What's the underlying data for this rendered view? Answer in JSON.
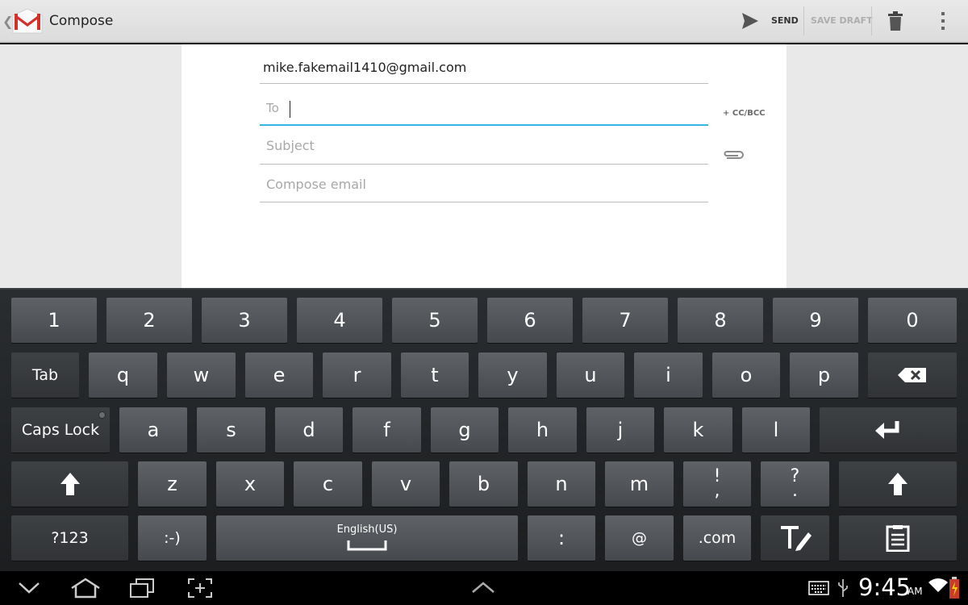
{
  "action_bar": {
    "title": "Compose",
    "send_label": "SEND",
    "save_draft_label": "SAVE DRAFT",
    "icons": [
      "back-chevron-icon",
      "gmail-logo",
      "send-icon",
      "trash-icon",
      "overflow-menu-icon"
    ]
  },
  "compose": {
    "from": "mike.fakemail1410@gmail.com",
    "to_placeholder": "To",
    "to_value": "",
    "cc_bcc_label": "+ CC/BCC",
    "subject_placeholder": "Subject",
    "body_placeholder": "Compose email",
    "accent_color": "#33b5e5"
  },
  "keyboard": {
    "language": "English(US)",
    "row1": [
      "1",
      "2",
      "3",
      "4",
      "5",
      "6",
      "7",
      "8",
      "9",
      "0"
    ],
    "row2": [
      "Tab",
      "q",
      "w",
      "e",
      "r",
      "t",
      "y",
      "u",
      "i",
      "o",
      "p"
    ],
    "row3": [
      "Caps Lock",
      "a",
      "s",
      "d",
      "f",
      "g",
      "h",
      "j",
      "k",
      "l"
    ],
    "row4": [
      "z",
      "x",
      "c",
      "v",
      "b",
      "n",
      "m",
      "!\n,",
      "?\n."
    ],
    "row5": [
      "?123",
      ":-)",
      ":",
      "@",
      ".com"
    ]
  },
  "status_bar": {
    "time": "9:45",
    "ampm": "AM"
  }
}
